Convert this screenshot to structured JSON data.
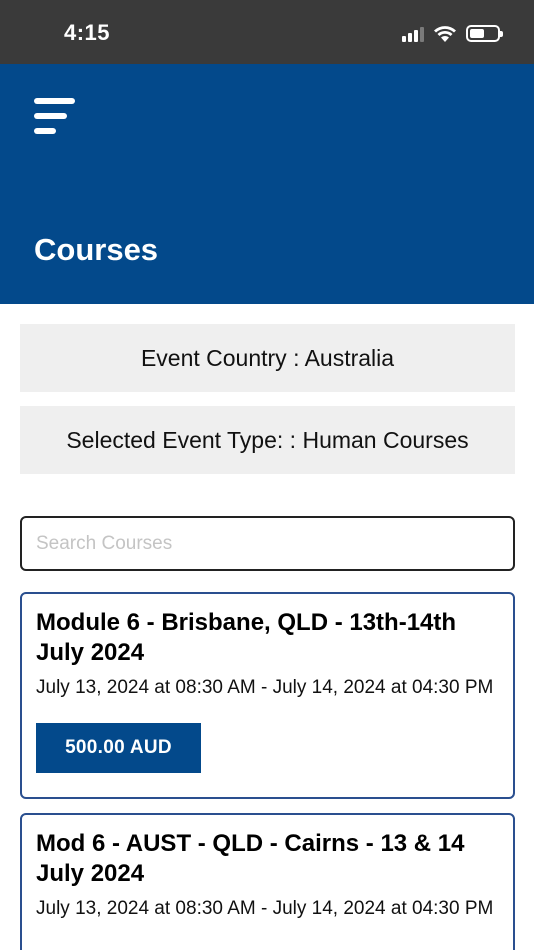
{
  "status_bar": {
    "time": "4:15",
    "battery_level": 0.55
  },
  "header": {
    "title": "Courses"
  },
  "filters": {
    "country": "Event Country : Australia",
    "event_type": "Selected Event Type: : Human Courses"
  },
  "search": {
    "placeholder": "Search Courses",
    "value": ""
  },
  "courses": [
    {
      "title": "Module 6 - Brisbane, QLD - 13th-14th July 2024",
      "dates": "July 13, 2024 at 08:30 AM - July 14, 2024 at 04:30 PM",
      "price": "500.00 AUD"
    },
    {
      "title": "Mod 6 - AUST - QLD - Cairns - 13 & 14 July 2024",
      "dates": "July 13, 2024 at 08:30 AM - July 14, 2024 at 04:30 PM"
    }
  ],
  "colors": {
    "header_bg": "#03498b",
    "status_bar_bg": "#3a3a3a",
    "card_border": "#2a4f8f",
    "filter_bg": "#efefef"
  }
}
